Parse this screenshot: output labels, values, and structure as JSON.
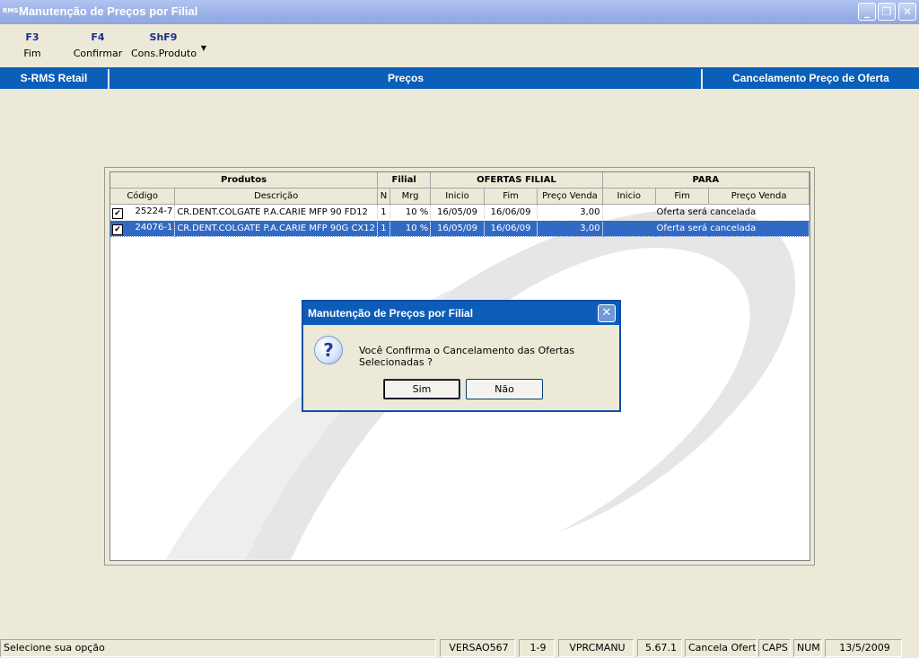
{
  "window": {
    "app_icon": "RMS",
    "title": "Manutenção de Preços por Filial",
    "controls": [
      "minimize-icon",
      "restore-icon",
      "close-icon"
    ]
  },
  "toolbar": {
    "buttons": [
      {
        "key": "F3",
        "label": "Fim"
      },
      {
        "key": "F4",
        "label": "Confirmar"
      },
      {
        "key": "ShF9",
        "label": "Cons.Produto"
      }
    ]
  },
  "band": {
    "left": "S-RMS Retail",
    "center": "Preços",
    "right": "Cancelamento Preço de Oferta"
  },
  "grid": {
    "groups": [
      "Produtos",
      "Filial",
      "OFERTAS FILIAL",
      "PARA"
    ],
    "columns": [
      "Código",
      "Descrição",
      "N",
      "Mrg",
      "Inicio",
      "Fim",
      "Preço Venda",
      "Inicio",
      "Fim",
      "Preço Venda"
    ],
    "rows": [
      {
        "checked": true,
        "selected": false,
        "codigo": "25224-7",
        "descricao": "CR.DENT.COLGATE P.A.CARIE MFP 90 FD12",
        "n": "1",
        "mrg": "10 %",
        "inicio": "16/05/09",
        "fim": "16/06/09",
        "preco": "3,00",
        "para": "Oferta será cancelada"
      },
      {
        "checked": true,
        "selected": true,
        "codigo": "24076-1",
        "descricao": "CR.DENT.COLGATE P.A.CARIE MFP 90G CX12",
        "n": "1",
        "mrg": "10 %",
        "inicio": "16/05/09",
        "fim": "16/06/09",
        "preco": "3,00",
        "para": "Oferta será cancelada"
      }
    ]
  },
  "dialog": {
    "title": "Manutenção de Preços por Filial",
    "icon": "question-icon",
    "message": "Você Confirma o Cancelamento das Ofertas Selecionadas ?",
    "yes_label": "Sim",
    "no_label": "Não"
  },
  "statusbar": {
    "message": "Selecione sua opção",
    "version": "VERSAO567",
    "range": "1-9",
    "program": "VPRCMANU",
    "release": "5.67.1",
    "action": "Cancela Oferta",
    "caps": "CAPS",
    "num": "NUM",
    "date": "13/5/2009"
  },
  "colors": {
    "band": "#0A5FB8",
    "selection": "#316AC5",
    "background": "#ECE9D8"
  }
}
